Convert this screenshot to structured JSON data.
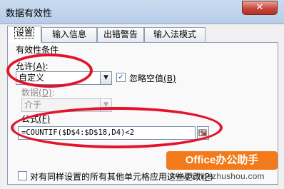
{
  "window": {
    "title": "数据有效性",
    "close_glyph": "✕"
  },
  "tabs": [
    {
      "label": "设置"
    },
    {
      "label": "输入信息"
    },
    {
      "label": "出错警告"
    },
    {
      "label": "输入法模式"
    }
  ],
  "settings": {
    "section_title": "有效性条件",
    "allow": {
      "label": "允许",
      "shortcut": "(A)",
      "suffix": ":",
      "value": "自定义"
    },
    "ignore_blank": {
      "label": "忽略空值",
      "shortcut": "(B)",
      "checked": true
    },
    "data": {
      "label": "数据",
      "shortcut": "(D)",
      "suffix": ":",
      "value": "介于"
    },
    "formula": {
      "label": "公式",
      "shortcut": "(F)",
      "value": "=COUNTIF($D$4:$D$18,D4)<2"
    },
    "apply_all": {
      "label": "对有同样设置的所有其他单元格应用这些更改(",
      "shortcut": "P",
      "suffix": ")",
      "checked": false
    }
  },
  "overlay": {
    "brand": "Office办公助手",
    "url": "www.officezhushou.com",
    "highlight_color": "#e2142d",
    "brand_color": "#f27a1a"
  }
}
